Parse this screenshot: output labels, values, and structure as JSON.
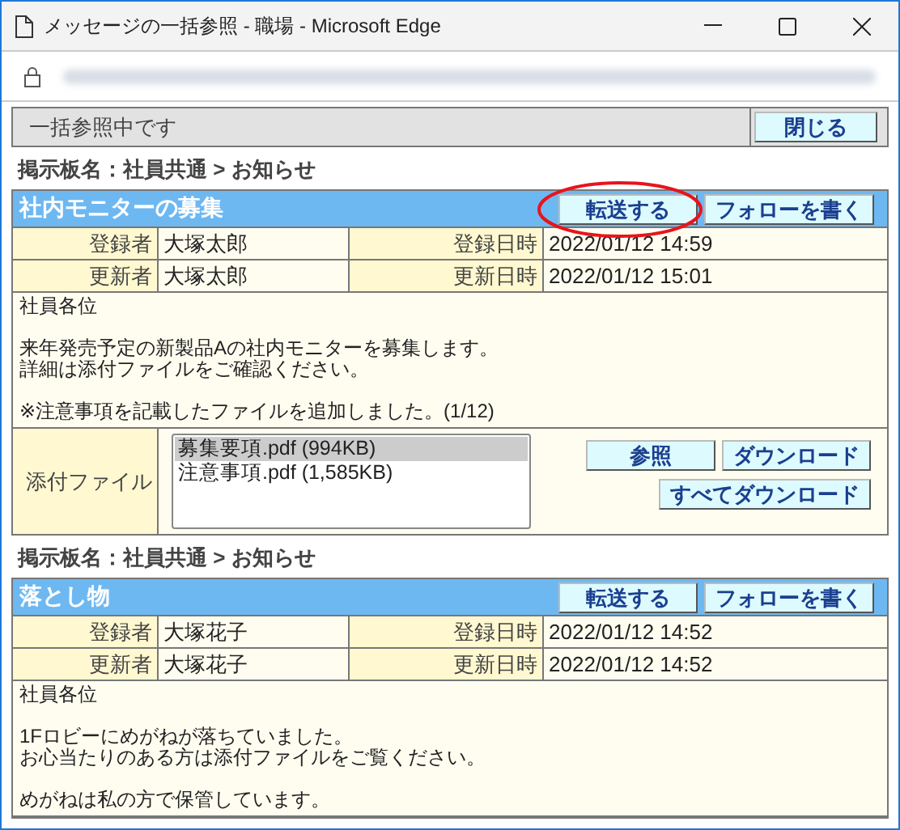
{
  "window": {
    "title": "メッセージの一括参照 - 職場 - Microsoft Edge"
  },
  "status_bar": {
    "text": "一括参照中です",
    "close_button": "閉じる"
  },
  "messages": [
    {
      "board": "掲示板名：社員共通 > お知らせ",
      "title": "社内モニターの募集",
      "forward_button": {
        "label": "転送する",
        "circled": true
      },
      "follow_button": "フォローを書く",
      "rows": [
        [
          {
            "label": "登録者",
            "value": "大塚太郎"
          },
          {
            "label": "登録日時",
            "value": "2022/01/12 14:59"
          }
        ],
        [
          {
            "label": "更新者",
            "value": "大塚太郎"
          },
          {
            "label": "更新日時",
            "value": "2022/01/12 15:01"
          }
        ]
      ],
      "body": [
        [
          "社員各位"
        ],
        [
          "来年発売予定の新製品Aの社内モニターを募集します。",
          "詳細は添付ファイルをご確認ください。"
        ],
        [
          "※注意事項を記載したファイルを追加しました。(1/12)"
        ]
      ],
      "attachments": {
        "label": "添付ファイル",
        "files": [
          {
            "name": "募集要項.pdf (994KB)",
            "selected": true
          },
          {
            "name": "注意事項.pdf (1,585KB)",
            "selected": false
          }
        ],
        "buttons": [
          "参照",
          "ダウンロード",
          "すべてダウンロード"
        ]
      }
    },
    {
      "board": "掲示板名：社員共通 > お知らせ",
      "title": "落とし物",
      "forward_button": {
        "label": "転送する",
        "circled": false
      },
      "follow_button": "フォローを書く",
      "rows": [
        [
          {
            "label": "登録者",
            "value": "大塚花子"
          },
          {
            "label": "登録日時",
            "value": "2022/01/12 14:52"
          }
        ],
        [
          {
            "label": "更新者",
            "value": "大塚花子"
          },
          {
            "label": "更新日時",
            "value": "2022/01/12 14:52"
          }
        ]
      ],
      "body": [
        [
          "社員各位"
        ],
        [
          "1Fロビーにめがねが落ちていました。",
          "お心当たりのある方は添付ファイルをご覧ください。"
        ],
        [
          "めがねは私の方で保管しています。"
        ]
      ]
    }
  ]
}
